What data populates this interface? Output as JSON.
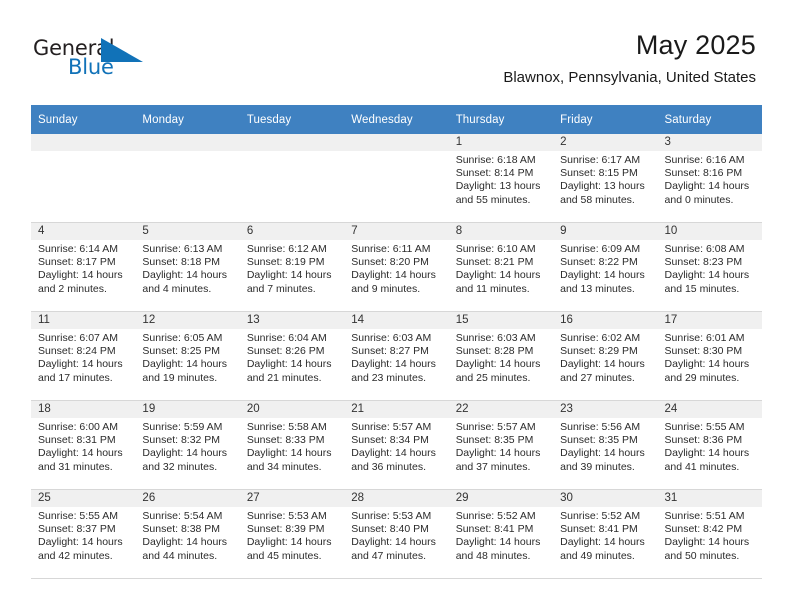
{
  "brand": {
    "name_dark": "General",
    "name_blue": "Blue",
    "accent_color": "#1172b8"
  },
  "header": {
    "title": "May 2025",
    "subtitle": "Blawnox, Pennsylvania, United States"
  },
  "calendar": {
    "header_bg": "#3f81c1",
    "weekday_headers": [
      "Sunday",
      "Monday",
      "Tuesday",
      "Wednesday",
      "Thursday",
      "Friday",
      "Saturday"
    ],
    "weeks": [
      [
        {
          "day": "",
          "sunrise": "",
          "sunset": "",
          "daylight_1": "",
          "daylight_2": "",
          "empty": true
        },
        {
          "day": "",
          "sunrise": "",
          "sunset": "",
          "daylight_1": "",
          "daylight_2": "",
          "empty": true
        },
        {
          "day": "",
          "sunrise": "",
          "sunset": "",
          "daylight_1": "",
          "daylight_2": "",
          "empty": true
        },
        {
          "day": "",
          "sunrise": "",
          "sunset": "",
          "daylight_1": "",
          "daylight_2": "",
          "empty": true
        },
        {
          "day": "1",
          "sunrise": "Sunrise: 6:18 AM",
          "sunset": "Sunset: 8:14 PM",
          "daylight_1": "Daylight: 13 hours",
          "daylight_2": "and 55 minutes.",
          "empty": false
        },
        {
          "day": "2",
          "sunrise": "Sunrise: 6:17 AM",
          "sunset": "Sunset: 8:15 PM",
          "daylight_1": "Daylight: 13 hours",
          "daylight_2": "and 58 minutes.",
          "empty": false
        },
        {
          "day": "3",
          "sunrise": "Sunrise: 6:16 AM",
          "sunset": "Sunset: 8:16 PM",
          "daylight_1": "Daylight: 14 hours",
          "daylight_2": "and 0 minutes.",
          "empty": false
        }
      ],
      [
        {
          "day": "4",
          "sunrise": "Sunrise: 6:14 AM",
          "sunset": "Sunset: 8:17 PM",
          "daylight_1": "Daylight: 14 hours",
          "daylight_2": "and 2 minutes.",
          "empty": false
        },
        {
          "day": "5",
          "sunrise": "Sunrise: 6:13 AM",
          "sunset": "Sunset: 8:18 PM",
          "daylight_1": "Daylight: 14 hours",
          "daylight_2": "and 4 minutes.",
          "empty": false
        },
        {
          "day": "6",
          "sunrise": "Sunrise: 6:12 AM",
          "sunset": "Sunset: 8:19 PM",
          "daylight_1": "Daylight: 14 hours",
          "daylight_2": "and 7 minutes.",
          "empty": false
        },
        {
          "day": "7",
          "sunrise": "Sunrise: 6:11 AM",
          "sunset": "Sunset: 8:20 PM",
          "daylight_1": "Daylight: 14 hours",
          "daylight_2": "and 9 minutes.",
          "empty": false
        },
        {
          "day": "8",
          "sunrise": "Sunrise: 6:10 AM",
          "sunset": "Sunset: 8:21 PM",
          "daylight_1": "Daylight: 14 hours",
          "daylight_2": "and 11 minutes.",
          "empty": false
        },
        {
          "day": "9",
          "sunrise": "Sunrise: 6:09 AM",
          "sunset": "Sunset: 8:22 PM",
          "daylight_1": "Daylight: 14 hours",
          "daylight_2": "and 13 minutes.",
          "empty": false
        },
        {
          "day": "10",
          "sunrise": "Sunrise: 6:08 AM",
          "sunset": "Sunset: 8:23 PM",
          "daylight_1": "Daylight: 14 hours",
          "daylight_2": "and 15 minutes.",
          "empty": false
        }
      ],
      [
        {
          "day": "11",
          "sunrise": "Sunrise: 6:07 AM",
          "sunset": "Sunset: 8:24 PM",
          "daylight_1": "Daylight: 14 hours",
          "daylight_2": "and 17 minutes.",
          "empty": false
        },
        {
          "day": "12",
          "sunrise": "Sunrise: 6:05 AM",
          "sunset": "Sunset: 8:25 PM",
          "daylight_1": "Daylight: 14 hours",
          "daylight_2": "and 19 minutes.",
          "empty": false
        },
        {
          "day": "13",
          "sunrise": "Sunrise: 6:04 AM",
          "sunset": "Sunset: 8:26 PM",
          "daylight_1": "Daylight: 14 hours",
          "daylight_2": "and 21 minutes.",
          "empty": false
        },
        {
          "day": "14",
          "sunrise": "Sunrise: 6:03 AM",
          "sunset": "Sunset: 8:27 PM",
          "daylight_1": "Daylight: 14 hours",
          "daylight_2": "and 23 minutes.",
          "empty": false
        },
        {
          "day": "15",
          "sunrise": "Sunrise: 6:03 AM",
          "sunset": "Sunset: 8:28 PM",
          "daylight_1": "Daylight: 14 hours",
          "daylight_2": "and 25 minutes.",
          "empty": false
        },
        {
          "day": "16",
          "sunrise": "Sunrise: 6:02 AM",
          "sunset": "Sunset: 8:29 PM",
          "daylight_1": "Daylight: 14 hours",
          "daylight_2": "and 27 minutes.",
          "empty": false
        },
        {
          "day": "17",
          "sunrise": "Sunrise: 6:01 AM",
          "sunset": "Sunset: 8:30 PM",
          "daylight_1": "Daylight: 14 hours",
          "daylight_2": "and 29 minutes.",
          "empty": false
        }
      ],
      [
        {
          "day": "18",
          "sunrise": "Sunrise: 6:00 AM",
          "sunset": "Sunset: 8:31 PM",
          "daylight_1": "Daylight: 14 hours",
          "daylight_2": "and 31 minutes.",
          "empty": false
        },
        {
          "day": "19",
          "sunrise": "Sunrise: 5:59 AM",
          "sunset": "Sunset: 8:32 PM",
          "daylight_1": "Daylight: 14 hours",
          "daylight_2": "and 32 minutes.",
          "empty": false
        },
        {
          "day": "20",
          "sunrise": "Sunrise: 5:58 AM",
          "sunset": "Sunset: 8:33 PM",
          "daylight_1": "Daylight: 14 hours",
          "daylight_2": "and 34 minutes.",
          "empty": false
        },
        {
          "day": "21",
          "sunrise": "Sunrise: 5:57 AM",
          "sunset": "Sunset: 8:34 PM",
          "daylight_1": "Daylight: 14 hours",
          "daylight_2": "and 36 minutes.",
          "empty": false
        },
        {
          "day": "22",
          "sunrise": "Sunrise: 5:57 AM",
          "sunset": "Sunset: 8:35 PM",
          "daylight_1": "Daylight: 14 hours",
          "daylight_2": "and 37 minutes.",
          "empty": false
        },
        {
          "day": "23",
          "sunrise": "Sunrise: 5:56 AM",
          "sunset": "Sunset: 8:35 PM",
          "daylight_1": "Daylight: 14 hours",
          "daylight_2": "and 39 minutes.",
          "empty": false
        },
        {
          "day": "24",
          "sunrise": "Sunrise: 5:55 AM",
          "sunset": "Sunset: 8:36 PM",
          "daylight_1": "Daylight: 14 hours",
          "daylight_2": "and 41 minutes.",
          "empty": false
        }
      ],
      [
        {
          "day": "25",
          "sunrise": "Sunrise: 5:55 AM",
          "sunset": "Sunset: 8:37 PM",
          "daylight_1": "Daylight: 14 hours",
          "daylight_2": "and 42 minutes.",
          "empty": false
        },
        {
          "day": "26",
          "sunrise": "Sunrise: 5:54 AM",
          "sunset": "Sunset: 8:38 PM",
          "daylight_1": "Daylight: 14 hours",
          "daylight_2": "and 44 minutes.",
          "empty": false
        },
        {
          "day": "27",
          "sunrise": "Sunrise: 5:53 AM",
          "sunset": "Sunset: 8:39 PM",
          "daylight_1": "Daylight: 14 hours",
          "daylight_2": "and 45 minutes.",
          "empty": false
        },
        {
          "day": "28",
          "sunrise": "Sunrise: 5:53 AM",
          "sunset": "Sunset: 8:40 PM",
          "daylight_1": "Daylight: 14 hours",
          "daylight_2": "and 47 minutes.",
          "empty": false
        },
        {
          "day": "29",
          "sunrise": "Sunrise: 5:52 AM",
          "sunset": "Sunset: 8:41 PM",
          "daylight_1": "Daylight: 14 hours",
          "daylight_2": "and 48 minutes.",
          "empty": false
        },
        {
          "day": "30",
          "sunrise": "Sunrise: 5:52 AM",
          "sunset": "Sunset: 8:41 PM",
          "daylight_1": "Daylight: 14 hours",
          "daylight_2": "and 49 minutes.",
          "empty": false
        },
        {
          "day": "31",
          "sunrise": "Sunrise: 5:51 AM",
          "sunset": "Sunset: 8:42 PM",
          "daylight_1": "Daylight: 14 hours",
          "daylight_2": "and 50 minutes.",
          "empty": false
        }
      ]
    ]
  }
}
